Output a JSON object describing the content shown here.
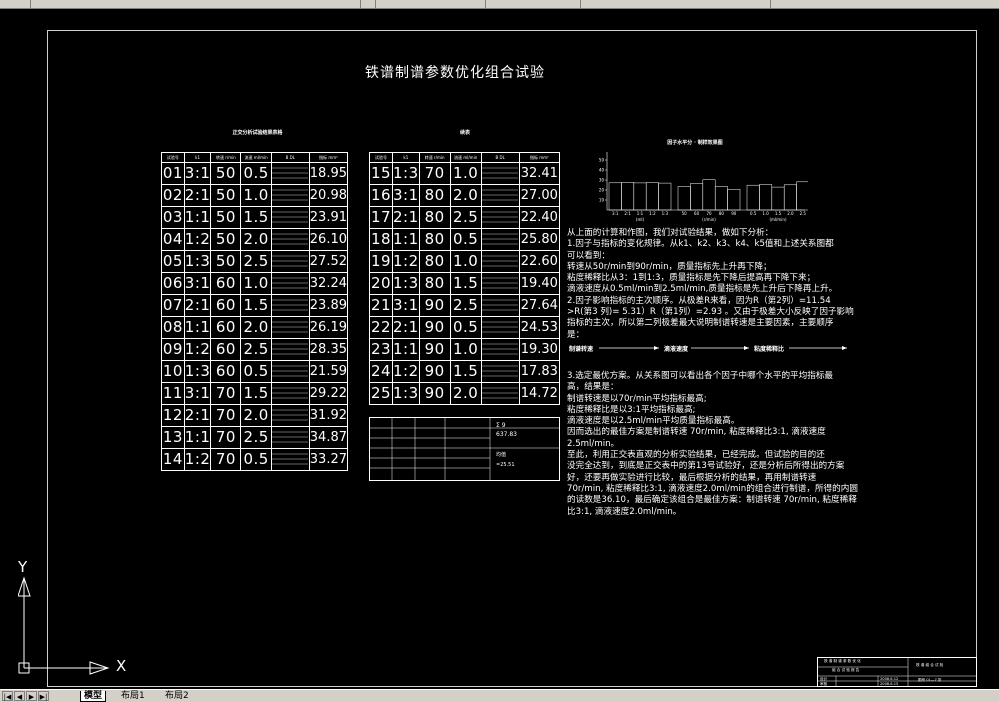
{
  "drawing": {
    "title": "铁谱制谱参数优化组合试验",
    "table1_caption": "正交分析试验结果表格",
    "table2_caption": "续表",
    "chart_title": "因子水平分 · 制样效果图"
  },
  "table_headers": [
    "试验号",
    "k1",
    "转速 r/min",
    "流速 ml/min",
    "B  DL",
    "指标 mm²"
  ],
  "table1": [
    {
      "a": "01",
      "b": "3:1",
      "c": "50",
      "d": "0.5",
      "e": "18.95"
    },
    {
      "a": "02",
      "b": "2:1",
      "c": "50",
      "d": "1.0",
      "e": "20.98"
    },
    {
      "a": "03",
      "b": "1:1",
      "c": "50",
      "d": "1.5",
      "e": "23.91"
    },
    {
      "a": "04",
      "b": "1:2",
      "c": "50",
      "d": "2.0",
      "e": "26.10"
    },
    {
      "a": "05",
      "b": "1:3",
      "c": "50",
      "d": "2.5",
      "e": "27.52"
    },
    {
      "a": "06",
      "b": "3:1",
      "c": "60",
      "d": "1.0",
      "e": "32.24"
    },
    {
      "a": "07",
      "b": "2:1",
      "c": "60",
      "d": "1.5",
      "e": "23.89"
    },
    {
      "a": "08",
      "b": "1:1",
      "c": "60",
      "d": "2.0",
      "e": "26.19"
    },
    {
      "a": "09",
      "b": "1:2",
      "c": "60",
      "d": "2.5",
      "e": "28.35"
    },
    {
      "a": "10",
      "b": "1:3",
      "c": "60",
      "d": "0.5",
      "e": "21.59"
    },
    {
      "a": "11",
      "b": "3:1",
      "c": "70",
      "d": "1.5",
      "e": "29.22"
    },
    {
      "a": "12",
      "b": "2:1",
      "c": "70",
      "d": "2.0",
      "e": "31.92"
    },
    {
      "a": "13",
      "b": "1:1",
      "c": "70",
      "d": "2.5",
      "e": "34.87"
    },
    {
      "a": "14",
      "b": "1:2",
      "c": "70",
      "d": "0.5",
      "e": "33.27"
    }
  ],
  "table2": [
    {
      "a": "15",
      "b": "1:3",
      "c": "70",
      "d": "1.0",
      "e": "32.41"
    },
    {
      "a": "16",
      "b": "3:1",
      "c": "80",
      "d": "2.0",
      "e": "27.00"
    },
    {
      "a": "17",
      "b": "2:1",
      "c": "80",
      "d": "2.5",
      "e": "22.40"
    },
    {
      "a": "18",
      "b": "1:1",
      "c": "80",
      "d": "0.5",
      "e": "25.80"
    },
    {
      "a": "19",
      "b": "1:2",
      "c": "80",
      "d": "1.0",
      "e": "22.60"
    },
    {
      "a": "20",
      "b": "1:3",
      "c": "80",
      "d": "1.5",
      "e": "19.40"
    },
    {
      "a": "21",
      "b": "3:1",
      "c": "90",
      "d": "2.5",
      "e": "27.64"
    },
    {
      "a": "22",
      "b": "2:1",
      "c": "90",
      "d": "0.5",
      "e": "24.53"
    },
    {
      "a": "23",
      "b": "1:1",
      "c": "90",
      "d": "1.0",
      "e": "19.30"
    },
    {
      "a": "24",
      "b": "1:2",
      "c": "90",
      "d": "1.5",
      "e": "17.83"
    },
    {
      "a": "25",
      "b": "1:3",
      "c": "90",
      "d": "2.0",
      "e": "14.72"
    }
  ],
  "table2_extra": {
    "sum_label": "Σ  9",
    "sum_value": "637.83",
    "avg_label": "均值",
    "avg_value": "=25.51"
  },
  "analysis": {
    "lines": [
      "从上面的计算和作图，我们对试验结果，做如下分析：",
      "  1.因子与指标的变化规律。从k1、k2、k3、k4、k5值和上述关系图都",
      "可以看到：",
      "    转速从50r/min到90r/min，质量指标先上升再下降；",
      "    粘度稀释比从3：1到1:3，质量指标是先下降后提高再下降下来；",
      "    滴液速度从0.5ml/min到2.5ml/min,质量指标是先上升后下降再上升。",
      "  2.因子影响指标的主次顺序。从极差R来看，因为R（第2列）=11.54",
      ">R(第3 列)= 5.31）R（第1列）=2.93 。又由于极差大小反映了因子影响",
      "指标的主次，所以第二列极差最大说明制谱转速是主要因素，主要顺序",
      "是："
    ],
    "order_items": [
      "制谱转速",
      "滴液速度",
      "粘度稀释比"
    ],
    "lines2": [
      "    3.选定最优方案。从关系图可以看出各个因子中哪个水平的平均指标最",
      "高，结果是：",
      "      制谱转速是以70r/min平均指标最高;",
      "      粘度稀释比是以3:1平均指标最高;",
      "      滴液速度是以2.5ml/min平均质量指标最高。",
      "    因而选出的最佳方案是制谱转速 70r/min, 粘度稀释比3:1, 滴液速度",
      "2.5ml/min。",
      "    至此，利用正交表直观的分析实验结果，已经完成。但试验的目的还",
      "没完全达到，到底是正交表中的第13号试验好，还是分析后所得出的方案",
      "好，还要再做实验进行比较，最后根据分析的结果，再用制谱转速",
      "70r/min, 粘度稀释比3:1, 滴液速度2.0ml/min的组合进行制谱，所得的内圆",
      "的读数是36.10，最后确定该组合是最佳方案：制谱转速 70r/min, 粘度稀释",
      "比3:1, 滴液速度2.0ml/min。"
    ]
  },
  "chart_data": {
    "type": "bar",
    "title": "因子水平分 · 制样效果图",
    "groups": [
      {
        "categories": [
          "3:1",
          "2:1",
          "1:1",
          "1:2",
          "1:3"
        ],
        "values": [
          27.2,
          27.6,
          27.1,
          27.4,
          26.9
        ],
        "unit": "(ml)"
      },
      {
        "categories": [
          "50",
          "60",
          "70",
          "80",
          "90"
        ],
        "values": [
          23.5,
          26.5,
          30.3,
          23.4,
          20.7
        ],
        "unit": "(r/min)"
      },
      {
        "categories": [
          "0.5",
          "1.0",
          "1.5",
          "2.0",
          "2.5"
        ],
        "values": [
          24.8,
          25.5,
          22.9,
          25.2,
          28.2
        ],
        "unit": "(ml/min)"
      }
    ],
    "yticks": [
      "10",
      "20",
      "30",
      "40",
      "50"
    ],
    "ylim": [
      0,
      50
    ]
  },
  "axis_labels": {
    "x": "X",
    "y": "Y"
  },
  "tabs": [
    "模型",
    "布局1",
    "布局2"
  ],
  "titleblock": {
    "r1": "铁 谱 制 谱 参 数 优 化",
    "r2": "组 合 试 验 报 告",
    "r3a": "设计",
    "r3b": "2008.6.12",
    "r4a": "审核",
    "r4b": "2008.6.15",
    "r5": "铁 谱 组 合 试 验",
    "r6": "图号 01—7 张"
  }
}
